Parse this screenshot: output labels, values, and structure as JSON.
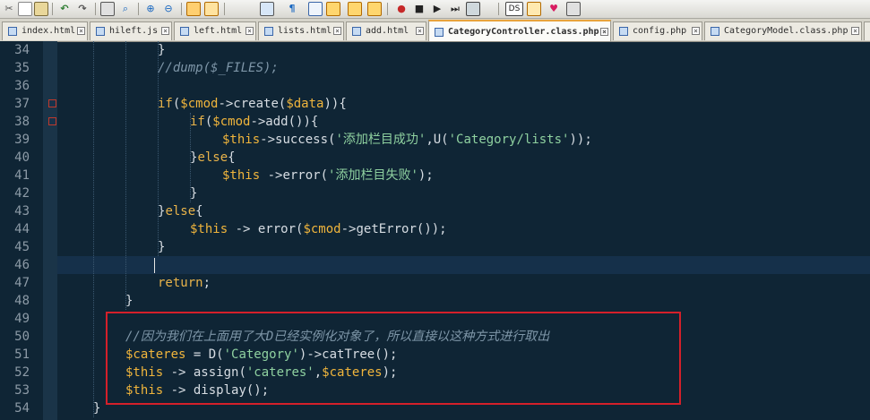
{
  "tabs": [
    {
      "label": "index.html",
      "active": false
    },
    {
      "label": "hileft.js",
      "active": false
    },
    {
      "label": "left.html",
      "active": false
    },
    {
      "label": "lists.html",
      "active": false
    },
    {
      "label": "add.html",
      "active": false
    },
    {
      "label": "CategoryController.class.php",
      "active": true
    },
    {
      "label": "config.php",
      "active": false
    },
    {
      "label": "CategoryModel.class.php",
      "active": false
    }
  ],
  "editor": {
    "line_numbers": [
      "34",
      "35",
      "36",
      "37",
      "38",
      "39",
      "40",
      "41",
      "42",
      "43",
      "44",
      "45",
      "46",
      "47",
      "48",
      "49",
      "50",
      "51",
      "52",
      "53",
      "54"
    ],
    "lines": [
      {
        "n": "34",
        "parts": [
          {
            "t": "}",
            "c": "p"
          }
        ]
      },
      {
        "n": "35",
        "parts": [
          {
            "t": "//dump($_FILES);",
            "c": "cmt"
          }
        ]
      },
      {
        "n": "36",
        "parts": []
      },
      {
        "n": "37",
        "parts": [
          {
            "t": "if",
            "c": "kw"
          },
          {
            "t": "(",
            "c": "p"
          },
          {
            "t": "$cmod",
            "c": "var"
          },
          {
            "t": "->create(",
            "c": "p"
          },
          {
            "t": "$data",
            "c": "var"
          },
          {
            "t": ")){",
            "c": "p"
          }
        ]
      },
      {
        "n": "38",
        "parts": [
          {
            "t": "if",
            "c": "kw"
          },
          {
            "t": "(",
            "c": "p"
          },
          {
            "t": "$cmod",
            "c": "var"
          },
          {
            "t": "->add()){",
            "c": "p"
          }
        ]
      },
      {
        "n": "39",
        "parts": [
          {
            "t": "$this",
            "c": "var"
          },
          {
            "t": "->success(",
            "c": "p"
          },
          {
            "t": "'添加栏目成功'",
            "c": "str"
          },
          {
            "t": ",U(",
            "c": "p"
          },
          {
            "t": "'Category/lists'",
            "c": "str"
          },
          {
            "t": "));",
            "c": "p"
          }
        ]
      },
      {
        "n": "40",
        "parts": [
          {
            "t": "}",
            "c": "p"
          },
          {
            "t": "else",
            "c": "kw"
          },
          {
            "t": "{",
            "c": "p"
          }
        ]
      },
      {
        "n": "41",
        "parts": [
          {
            "t": "$this",
            "c": "var"
          },
          {
            "t": " ->error(",
            "c": "p"
          },
          {
            "t": "'添加栏目失败'",
            "c": "str"
          },
          {
            "t": ");",
            "c": "p"
          }
        ]
      },
      {
        "n": "42",
        "parts": [
          {
            "t": "}",
            "c": "p"
          }
        ]
      },
      {
        "n": "43",
        "parts": [
          {
            "t": "}",
            "c": "p"
          },
          {
            "t": "else",
            "c": "kw"
          },
          {
            "t": "{",
            "c": "p"
          }
        ]
      },
      {
        "n": "44",
        "parts": [
          {
            "t": "$this",
            "c": "var"
          },
          {
            "t": " -> error(",
            "c": "p"
          },
          {
            "t": "$cmod",
            "c": "var"
          },
          {
            "t": "->getError());",
            "c": "p"
          }
        ]
      },
      {
        "n": "45",
        "parts": [
          {
            "t": "}",
            "c": "p"
          }
        ]
      },
      {
        "n": "46",
        "parts": []
      },
      {
        "n": "47",
        "parts": [
          {
            "t": "return",
            "c": "kw"
          },
          {
            "t": ";",
            "c": "p"
          }
        ]
      },
      {
        "n": "48",
        "parts": [
          {
            "t": "}",
            "c": "p"
          }
        ]
      },
      {
        "n": "49",
        "parts": []
      },
      {
        "n": "50",
        "parts": [
          {
            "t": "//因为我们在上面用了大D已经实例化对象了，所以直接以这种方式进行取出",
            "c": "cmt"
          }
        ]
      },
      {
        "n": "51",
        "parts": [
          {
            "t": "$cateres",
            "c": "var"
          },
          {
            "t": " = D(",
            "c": "p"
          },
          {
            "t": "'Category'",
            "c": "str"
          },
          {
            "t": ")->catTree();",
            "c": "p"
          }
        ]
      },
      {
        "n": "52",
        "parts": [
          {
            "t": "$this",
            "c": "var"
          },
          {
            "t": " -> assign(",
            "c": "p"
          },
          {
            "t": "'cateres'",
            "c": "str"
          },
          {
            "t": ",",
            "c": "p"
          },
          {
            "t": "$cateres",
            "c": "var"
          },
          {
            "t": ");",
            "c": "p"
          }
        ]
      },
      {
        "n": "53",
        "parts": [
          {
            "t": "$this",
            "c": "var"
          },
          {
            "t": " -> display();",
            "c": "p"
          }
        ]
      },
      {
        "n": "54",
        "parts": [
          {
            "t": "}",
            "c": "p"
          }
        ]
      }
    ]
  },
  "colors": {
    "background": "#0f2535",
    "keyword": "#e8b34a",
    "variable": "#f0b53c",
    "string": "#8fd1a0",
    "comment": "#7e96a8",
    "highlight_box": "#d4202a",
    "active_tab_accent": "#e8a33c"
  },
  "icons": [
    "cut-icon",
    "copy-icon",
    "paste-icon",
    "undo-icon",
    "redo-icon",
    "print-icon",
    "find-icon",
    "replace-icon",
    "zoom-in-icon",
    "zoom-out-icon",
    "sync-icon",
    "wrap-icon",
    "indent-guide-icon",
    "macro-record-icon",
    "macro-stop-icon",
    "macro-play-icon",
    "save-macro-icon",
    "favorite-icon",
    "spell-check-icon"
  ]
}
